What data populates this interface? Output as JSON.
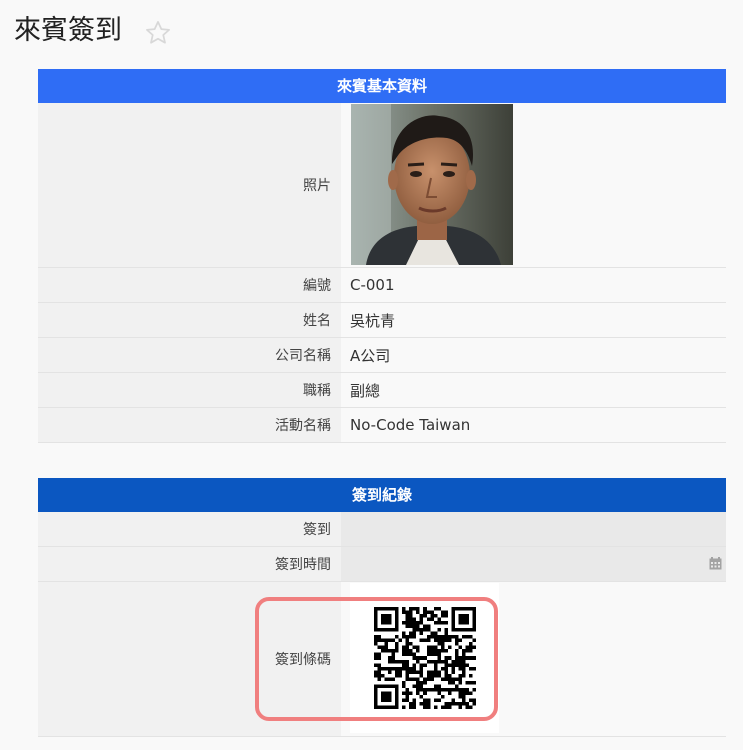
{
  "page": {
    "title": "來賓簽到"
  },
  "colors": {
    "panel1_header": "#2f6df5",
    "panel2_header": "#0b57c1",
    "highlight": "#f07f7f"
  },
  "guest_panel": {
    "title": "來賓基本資料",
    "photo_label": "照片",
    "fields": [
      {
        "label": "編號",
        "value": "C-001"
      },
      {
        "label": "姓名",
        "value": "吳杭青"
      },
      {
        "label": "公司名稱",
        "value": "A公司"
      },
      {
        "label": "職稱",
        "value": "副總"
      },
      {
        "label": "活動名稱",
        "value": "No-Code Taiwan"
      }
    ]
  },
  "checkin_panel": {
    "title": "簽到紀錄",
    "checkin_label": "簽到",
    "checkin_value": "",
    "time_label": "簽到時間",
    "time_value": "",
    "barcode_label": "簽到條碼"
  },
  "icons": {
    "favorite": "star-icon",
    "date_picker": "calendar-icon"
  }
}
